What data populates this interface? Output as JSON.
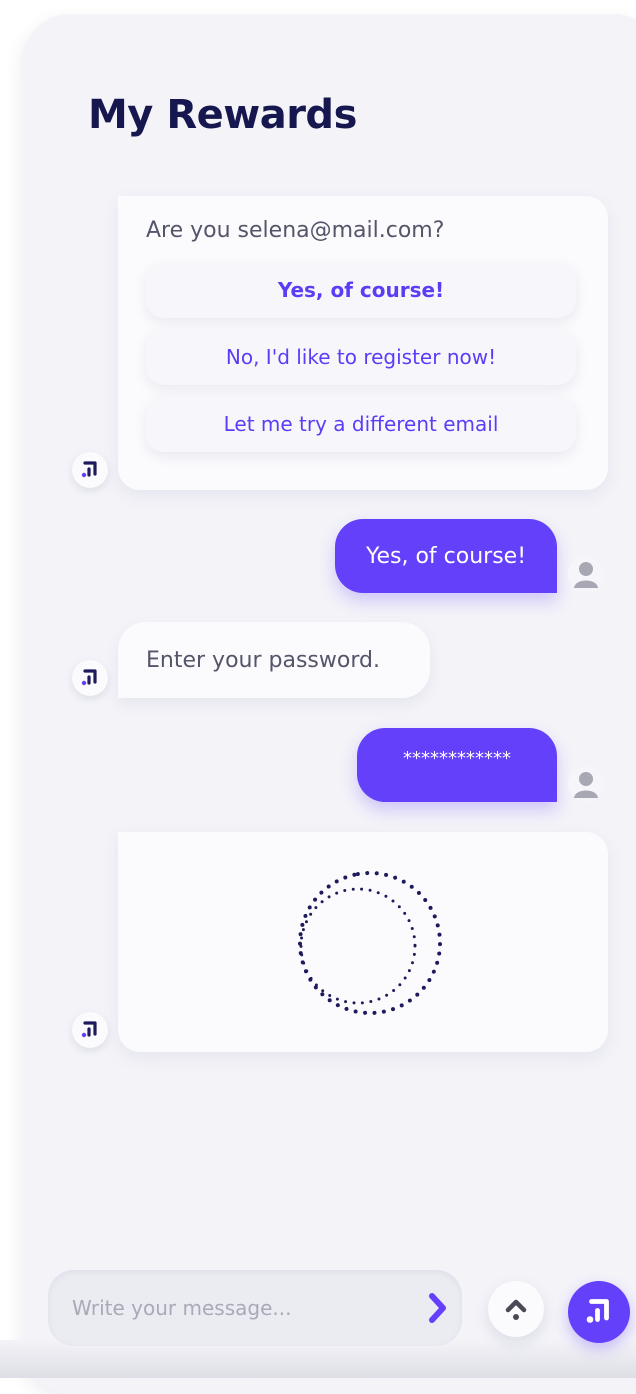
{
  "header": {
    "title_regular": "My",
    "title_bold": "Rewards"
  },
  "messages": {
    "email_prompt": {
      "question": "Are you selena@mail.com?",
      "options": [
        "Yes, of course!",
        "No, I'd like to register now!",
        "Let me try a different email"
      ]
    },
    "user_reply_1": "Yes, of course!",
    "bot_password_prompt": "Enter your password.",
    "user_reply_2": "************"
  },
  "composer": {
    "placeholder": "Write your message..."
  },
  "icons": {
    "bot_avatar": "brand-logo-icon",
    "user_avatar": "user-icon",
    "send": "chevron-right-icon",
    "scroll_up": "chevron-up-icon",
    "loading": "loading-spinner-icon"
  },
  "colors": {
    "accent": "#6440fb",
    "title": "#17174f",
    "background": "#f3f3f8",
    "spinner": "#1e1b5c"
  }
}
